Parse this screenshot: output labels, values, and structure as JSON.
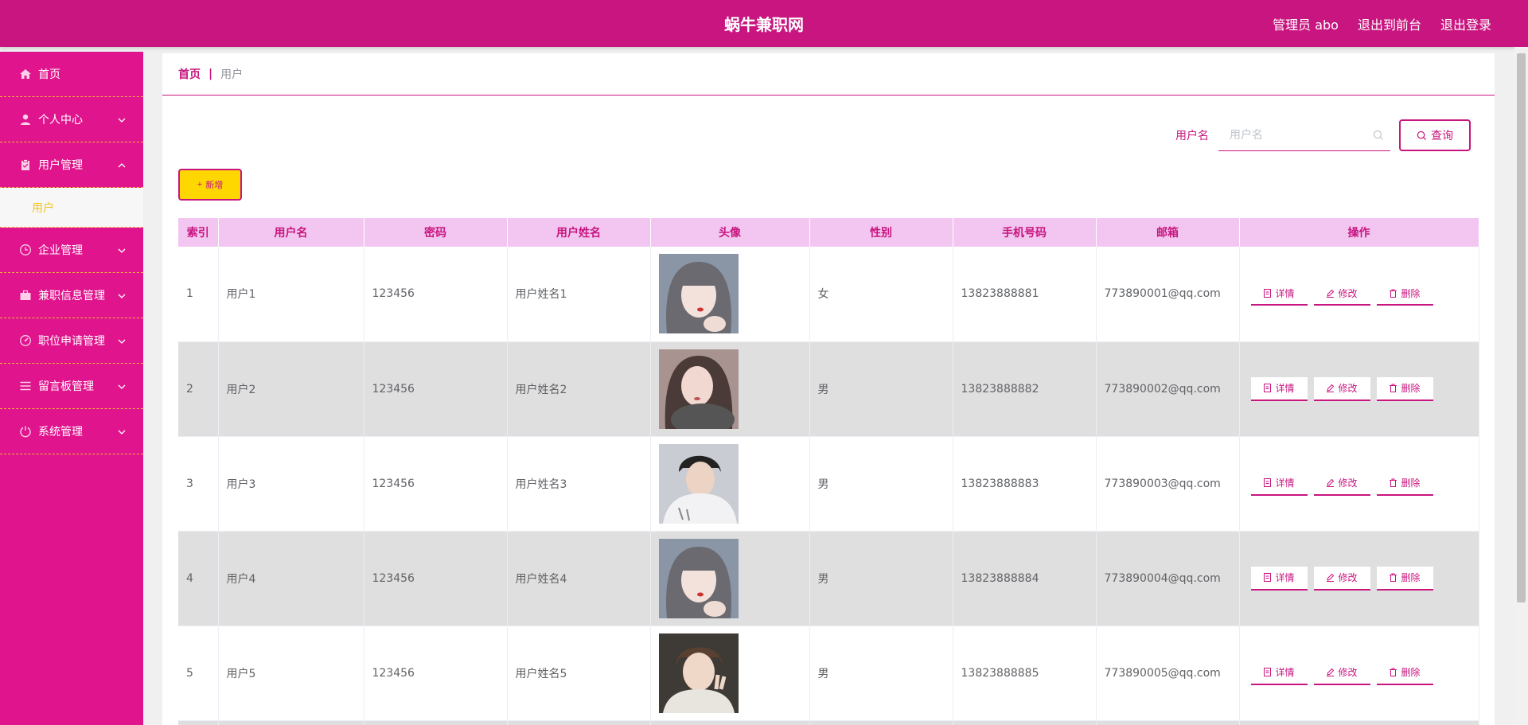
{
  "header": {
    "title": "蜗牛兼职网",
    "admin": "管理员 abo",
    "to_front": "退出到前台",
    "logout": "退出登录"
  },
  "sidebar": {
    "items": [
      {
        "label": "首页",
        "icon": "home-icon"
      },
      {
        "label": "个人中心",
        "icon": "user-icon"
      },
      {
        "label": "用户管理",
        "icon": "clipboard-icon"
      },
      {
        "label": "企业管理",
        "icon": "clock-icon"
      },
      {
        "label": "兼职信息管理",
        "icon": "briefcase-icon"
      },
      {
        "label": "职位申请管理",
        "icon": "gauge-icon"
      },
      {
        "label": "留言板管理",
        "icon": "menu-icon"
      },
      {
        "label": "系统管理",
        "icon": "power-icon"
      }
    ],
    "sub_active": "用户"
  },
  "breadcrumb": {
    "home": "首页",
    "sep": "|",
    "current": "用户"
  },
  "search": {
    "label": "用户名",
    "placeholder": "用户名",
    "button": "查询"
  },
  "toolbar": {
    "add_label": "新增"
  },
  "table": {
    "headers": [
      "索引",
      "用户名",
      "密码",
      "用户姓名",
      "头像",
      "性别",
      "手机号码",
      "邮箱",
      "操作"
    ],
    "rows": [
      {
        "index": "1",
        "username": "用户1",
        "password": "123456",
        "name": "用户姓名1",
        "gender": "女",
        "phone": "13823888881",
        "email": "773890001@qq.com"
      },
      {
        "index": "2",
        "username": "用户2",
        "password": "123456",
        "name": "用户姓名2",
        "gender": "男",
        "phone": "13823888882",
        "email": "773890002@qq.com"
      },
      {
        "index": "3",
        "username": "用户3",
        "password": "123456",
        "name": "用户姓名3",
        "gender": "男",
        "phone": "13823888883",
        "email": "773890003@qq.com"
      },
      {
        "index": "4",
        "username": "用户4",
        "password": "123456",
        "name": "用户姓名4",
        "gender": "男",
        "phone": "13823888884",
        "email": "773890004@qq.com"
      },
      {
        "index": "5",
        "username": "用户5",
        "password": "123456",
        "name": "用户姓名5",
        "gender": "男",
        "phone": "13823888885",
        "email": "773890005@qq.com"
      }
    ],
    "ops": {
      "detail": "详情",
      "edit": "修改",
      "delete": "删除"
    }
  },
  "colors": {
    "brand": "#c8157f",
    "sidebar": "#e0148d",
    "accent": "#ffd700",
    "header_bg": "#f2c6f0"
  }
}
